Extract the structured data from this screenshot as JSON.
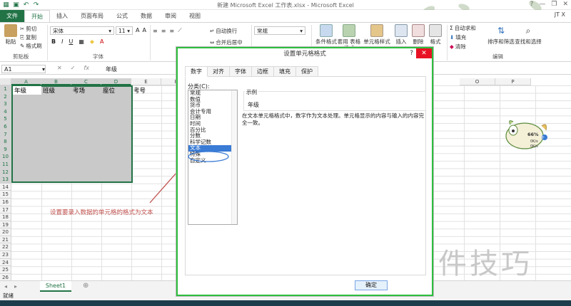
{
  "window": {
    "title": "新建 Microsoft Excel 工作表.xlsx - Microsoft Excel",
    "user": "JT X"
  },
  "ribbon_tabs": [
    "文件",
    "开始",
    "插入",
    "页面布局",
    "公式",
    "数据",
    "审阅",
    "视图"
  ],
  "ribbon": {
    "clipboard": {
      "paste": "粘贴",
      "cut": "剪切",
      "copy": "复制",
      "format_painter": "格式刷",
      "label": "剪贴板"
    },
    "font": {
      "name": "宋体",
      "size": "11",
      "label": "字体"
    },
    "alignment": {
      "wrap": "自动换行",
      "merge": "合并后居中"
    },
    "number": {
      "format": "常规"
    },
    "styles": {
      "conditional": "条件格式",
      "table": "套用\n表格格式",
      "cell_styles": "单元格样式"
    },
    "cells": {
      "insert": "插入",
      "delete": "删除",
      "format": "格式"
    },
    "editing": {
      "autosum": "自动求和",
      "fill": "填充",
      "clear": "清除",
      "sort": "排序和筛选",
      "find": "查找和选择",
      "label": "编辑"
    }
  },
  "formula_bar": {
    "name_box": "A1",
    "value": "年级"
  },
  "columns": [
    "A",
    "B",
    "C",
    "D",
    "E",
    "F",
    "G",
    "H",
    "I",
    "J",
    "K",
    "L",
    "M",
    "N",
    "O",
    "P"
  ],
  "rows": [
    "1",
    "2",
    "3",
    "4",
    "5",
    "6",
    "7",
    "8",
    "9",
    "10",
    "11",
    "12",
    "13",
    "14",
    "15",
    "16",
    "17",
    "18",
    "19",
    "20",
    "21",
    "22",
    "23",
    "24",
    "25",
    "26"
  ],
  "cells": {
    "A1": "年级",
    "B1": "班级",
    "C1": "考场",
    "D1": "座位",
    "E1": "考号"
  },
  "annotation": "设置要录入数据的单元格的格式为文本",
  "sheet_tab": "Sheet1",
  "status": "就绪",
  "dialog": {
    "title": "设置单元格格式",
    "help": "?",
    "close": "✕",
    "tabs": [
      "数字",
      "对齐",
      "字体",
      "边框",
      "填充",
      "保护"
    ],
    "category_label": "分类(C):",
    "categories": [
      "常规",
      "数值",
      "货币",
      "会计专用",
      "日期",
      "时间",
      "百分比",
      "分数",
      "科学记数",
      "文本",
      "特殊",
      "自定义"
    ],
    "selected_category": "文本",
    "example_label": "示例",
    "example_value": "年级",
    "description": "在文本单元格格式中，数字作为文本处理。单元格显示的内容与输入的内容完全一致。",
    "ok": "确定"
  },
  "mascot": {
    "percent": "66%",
    "up": "0K/s",
    "down": "0K/s"
  },
  "watermark": "软件技巧",
  "colors": {
    "excel_green": "#217346",
    "dialog_border": "#2dbe3d",
    "annotation_red": "#c0504d",
    "select_blue": "#3a7bd5"
  }
}
